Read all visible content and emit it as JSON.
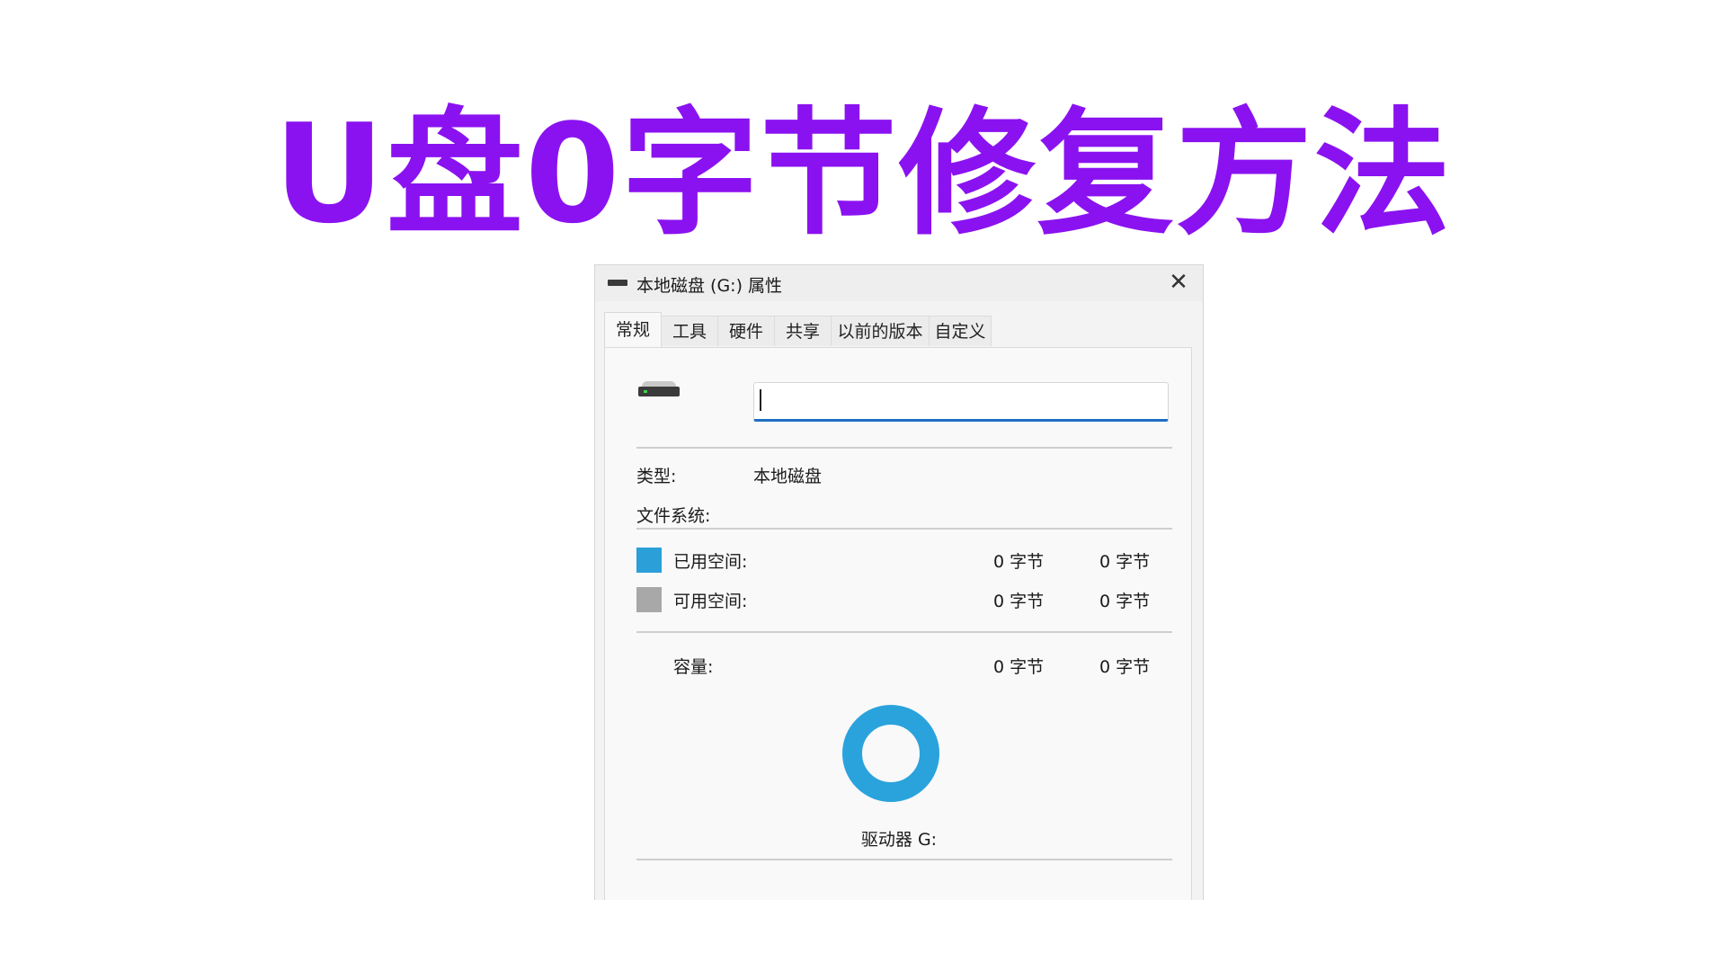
{
  "headline": "U盘0字节修复方法",
  "dialog": {
    "title": "本地磁盘 (G:) 属性",
    "close_glyph": "✕",
    "tabs": [
      "常规",
      "工具",
      "硬件",
      "共享",
      "以前的版本",
      "自定义"
    ],
    "active_tab": "常规",
    "name_input": {
      "value": "",
      "placeholder": ""
    },
    "type_label": "类型:",
    "type_value": "本地磁盘",
    "fs_label": "文件系统:",
    "fs_value": "",
    "used": {
      "label": "已用空间:",
      "bytes": "0 字节",
      "size": "0 字节",
      "color": "#2a9fd8"
    },
    "free": {
      "label": "可用空间:",
      "bytes": "0 字节",
      "size": "0 字节",
      "color": "#a8a8a8"
    },
    "capacity": {
      "label": "容量:",
      "bytes": "0 字节",
      "size": "0 字节"
    },
    "drive_label": "驱动器 G:",
    "ring_color": "#2aa3dd"
  },
  "colors": {
    "headline": "#8a12f0",
    "accent": "#1e6fc2"
  },
  "icons": {
    "title": "drive-icon",
    "close": "close-icon",
    "drive": "hard-drive-icon"
  }
}
